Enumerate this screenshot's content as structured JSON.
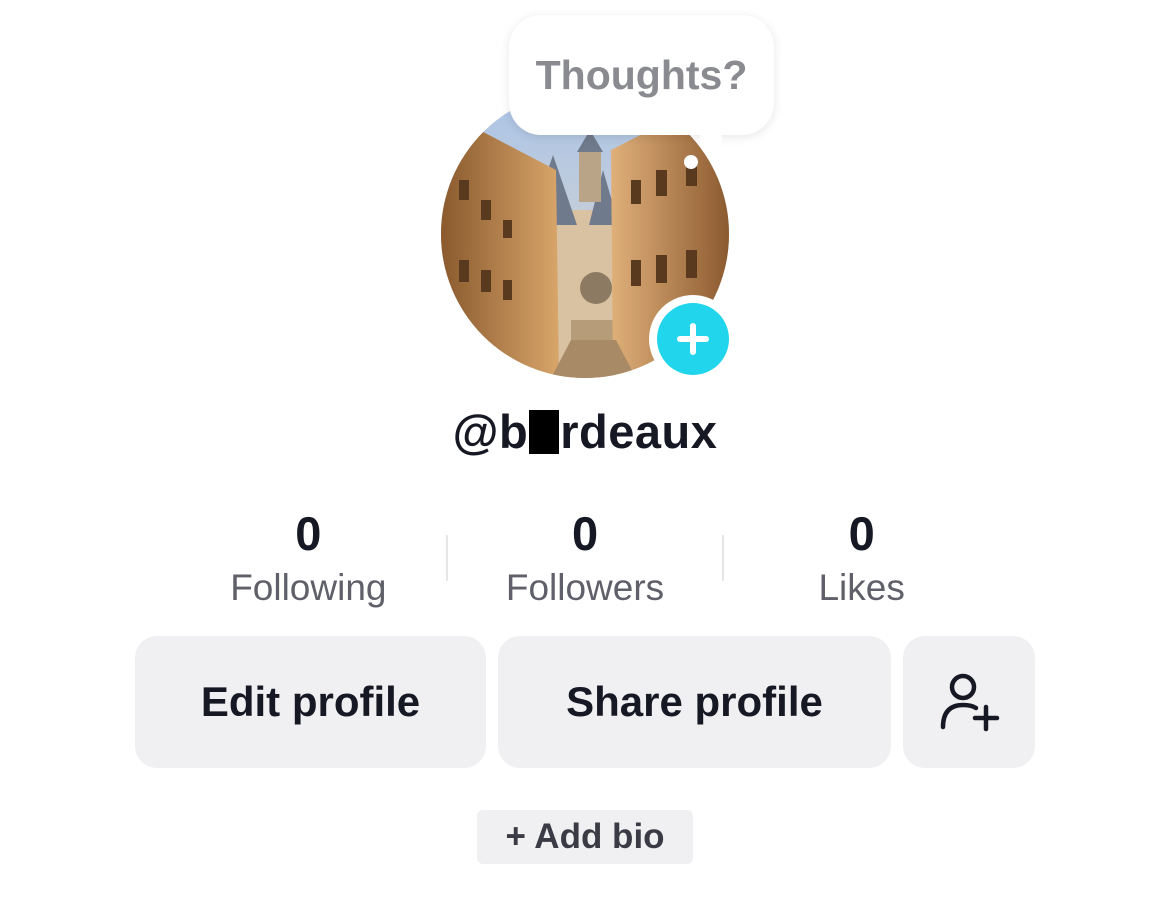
{
  "bubble": {
    "text": "Thoughts?"
  },
  "profile": {
    "username_prefix": "@b",
    "username_suffix": "rdeaux",
    "avatar_alt": "avatar",
    "add_icon": "plus-icon"
  },
  "stats": [
    {
      "value": "0",
      "label": "Following"
    },
    {
      "value": "0",
      "label": "Followers"
    },
    {
      "value": "0",
      "label": "Likes"
    }
  ],
  "buttons": {
    "edit_label": "Edit profile",
    "share_label": "Share profile",
    "add_friend_icon": "add-friend-icon"
  },
  "bio": {
    "add_label": "+ Add bio"
  },
  "colors": {
    "accent": "#20d5ec",
    "button_bg": "#f0f0f2",
    "text_primary": "#161823",
    "text_secondary": "#5f6069",
    "bubble_text": "#8a8b91"
  }
}
